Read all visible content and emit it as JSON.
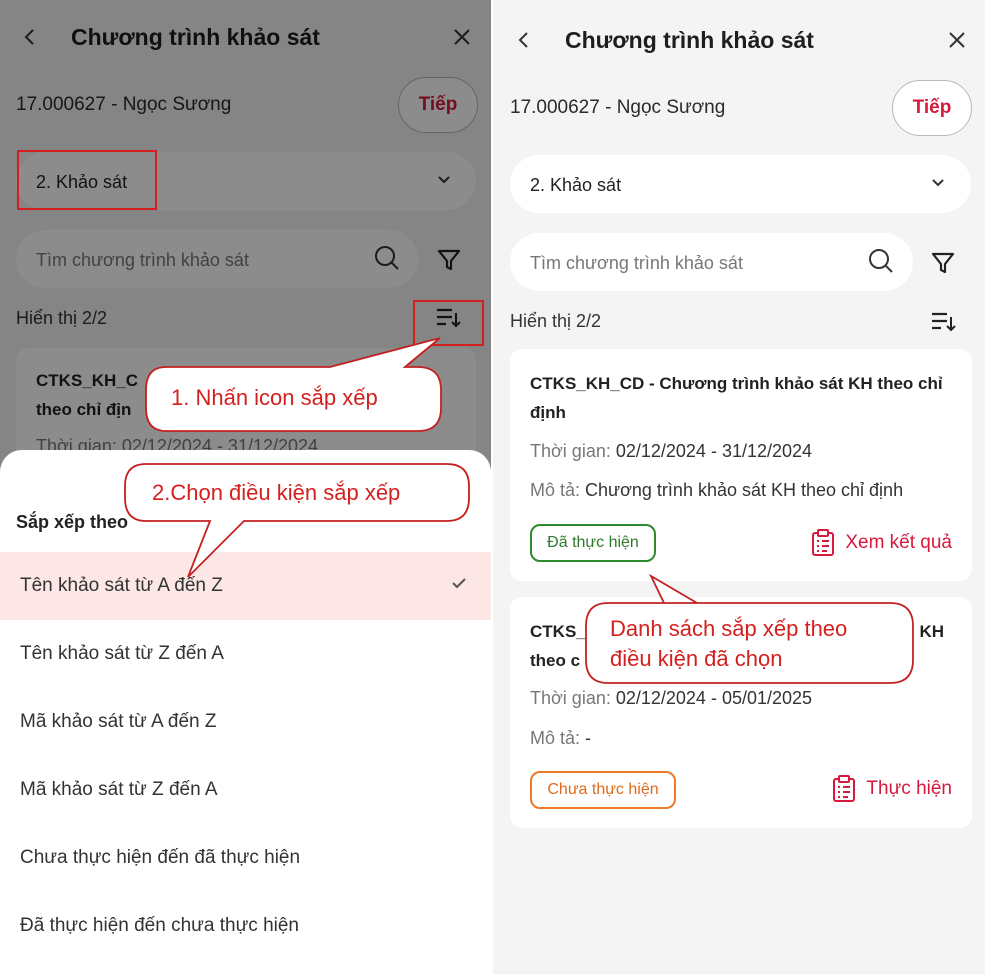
{
  "header": {
    "title": "Chương trình khảo sát",
    "back_icon": "chevron-left-icon",
    "close_icon": "close-icon"
  },
  "user_code": "17.000627 - Ngọc Sương",
  "next_label": "Tiếp",
  "step_select": {
    "value": "2. Khảo sát"
  },
  "search": {
    "placeholder": "Tìm chương trình khảo sát"
  },
  "result_count": "Hiển thị 2/2",
  "left_behind": {
    "card_title": "CTKS_KH_C",
    "card_title_2": "theo chỉ địn",
    "time": "Thời gian: 02/12/2024 - 31/12/2024"
  },
  "sort_sheet": {
    "title": "Sắp xếp theo",
    "options": [
      "Tên khảo sát từ A đến Z",
      "Tên khảo sát từ Z đến A",
      "Mã khảo sát từ A đến Z",
      "Mã khảo sát từ Z đến A",
      "Chưa thực hiện đến đã thực hiện",
      "Đã thực hiện đến chưa thực hiện"
    ],
    "selected_index": 0
  },
  "cards": [
    {
      "title": "CTKS_KH_CD - Chương trình khảo sát KH theo chỉ định",
      "time_label": "Thời gian:",
      "time_value": "02/12/2024 - 31/12/2024",
      "desc_label": "Mô tả:",
      "desc_value": "Chương trình khảo sát KH theo chỉ định",
      "status": "Đã thực hiện",
      "action": "Xem kết quả"
    },
    {
      "title_left": "CTKS_",
      "title_right": "KH",
      "title_line2": "theo c",
      "time_label": "Thời gian:",
      "time_value": "02/12/2024 - 05/01/2025",
      "desc_label": "Mô tả:",
      "desc_value": "-",
      "status": "Chưa thực hiện",
      "action": "Thực hiện"
    }
  ],
  "callouts": {
    "step1": "1. Nhấn icon sắp xếp",
    "step2": "2.Chọn điều kiện sắp xếp",
    "result_line1": "Danh sách sắp xếp theo",
    "result_line2": "điều kiện đã chọn"
  },
  "colors": {
    "accent": "#d7193d",
    "done": "#2d8a2d",
    "todo": "#ee7a2a",
    "annotation": "#d41f1f"
  }
}
